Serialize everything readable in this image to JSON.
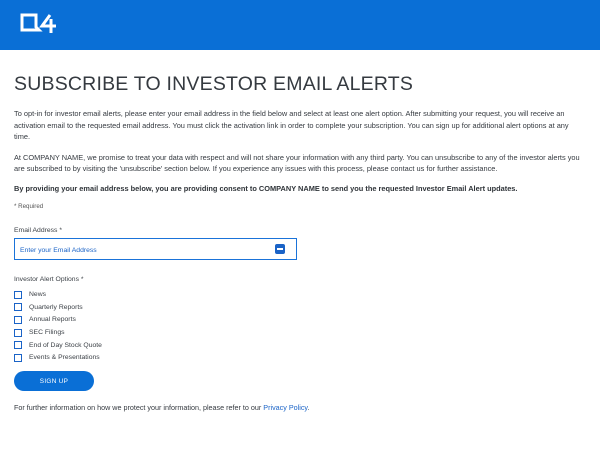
{
  "brand": {
    "logo_text": "Q4",
    "header_color": "#0a6fd6"
  },
  "page": {
    "title": "SUBSCRIBE TO INVESTOR EMAIL ALERTS",
    "intro_paragraph_1": "To opt-in for investor email alerts, please enter your email address in the field below and select at least one alert option. After submitting your request, you will receive an activation email to the requested email address. You must click the activation link in order to complete your subscription. You can sign up for additional alert options at any time.",
    "intro_paragraph_2": "At COMPANY NAME, we promise to treat your data with respect and will not share your information with any third party. You can unsubscribe to any of the investor alerts you are subscribed to by visiting the 'unsubscribe' section below. If you experience any issues with this process, please contact us for further assistance.",
    "consent_text": "By providing your email address below, you are providing consent to COMPANY NAME to send you the requested Investor Email Alert updates.",
    "required_note": "* Required"
  },
  "form": {
    "email_label": "Email Address *",
    "email_placeholder": "Enter your Email Address",
    "email_value": "",
    "options_label": "Investor Alert Options *",
    "options": [
      {
        "label": "News",
        "checked": false
      },
      {
        "label": "Quarterly Reports",
        "checked": false
      },
      {
        "label": "Annual Reports",
        "checked": false
      },
      {
        "label": "SEC Filings",
        "checked": false
      },
      {
        "label": "End of Day Stock Quote",
        "checked": false
      },
      {
        "label": "Events & Presentations",
        "checked": false
      }
    ],
    "submit_label": "SIGN UP"
  },
  "footer": {
    "text_before_link": "For further information on how we protect your information, please refer to our ",
    "link_text": "Privacy Policy",
    "text_after_link": "."
  }
}
